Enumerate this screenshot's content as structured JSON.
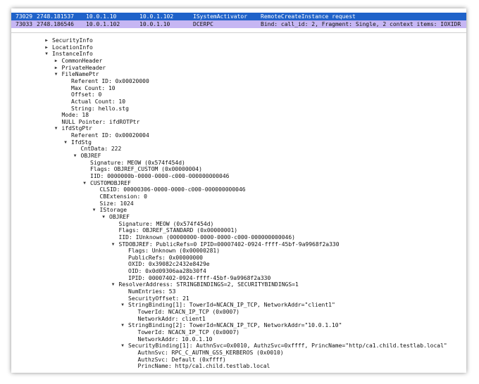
{
  "packet_list": [
    {
      "no": "73029",
      "time": "2748.181537",
      "src": "10.0.1.10",
      "dst": "10.0.1.102",
      "proto": "ISystemActivator",
      "info": "RemoteCreateInstance request",
      "selected": true
    },
    {
      "no": "73033",
      "time": "2748.186546",
      "src": "10.0.1.102",
      "dst": "10.0.1.10",
      "proto": "DCERPC",
      "info": "Bind: call_id: 2, Fragment: Single, 2 context items: IOXIDR",
      "selected": false
    }
  ],
  "detail_tree": [
    {
      "text": "SecurityInfo",
      "depth": 0,
      "toggle": "collapsed"
    },
    {
      "text": "LocationInfo",
      "depth": 0,
      "toggle": "collapsed"
    },
    {
      "text": "InstanceInfo",
      "depth": 0,
      "toggle": "expanded"
    },
    {
      "text": "CommonHeader",
      "depth": 1,
      "toggle": "collapsed"
    },
    {
      "text": "PrivateHeader",
      "depth": 1,
      "toggle": "collapsed"
    },
    {
      "text": "FileNamePtr",
      "depth": 1,
      "toggle": "expanded"
    },
    {
      "text": "Referent ID: 0x00020000",
      "depth": 2,
      "toggle": "none"
    },
    {
      "text": "Max Count: 10",
      "depth": 2,
      "toggle": "none"
    },
    {
      "text": "Offset: 0",
      "depth": 2,
      "toggle": "none"
    },
    {
      "text": "Actual Count: 10",
      "depth": 2,
      "toggle": "none"
    },
    {
      "text": "String: hello.stg",
      "depth": 2,
      "toggle": "none"
    },
    {
      "text": "Mode: 18",
      "depth": 1,
      "toggle": "none"
    },
    {
      "text": "NULL Pointer: ifdROTPtr",
      "depth": 1,
      "toggle": "none"
    },
    {
      "text": "ifdStgPtr",
      "depth": 1,
      "toggle": "expanded"
    },
    {
      "text": "Referent ID: 0x00020004",
      "depth": 2,
      "toggle": "none"
    },
    {
      "text": "IfdStg",
      "depth": 2,
      "toggle": "expanded"
    },
    {
      "text": "CntData: 222",
      "depth": 3,
      "toggle": "none"
    },
    {
      "text": "OBJREF",
      "depth": 3,
      "toggle": "expanded"
    },
    {
      "text": "Signature: MEOW (0x574f454d)",
      "depth": 4,
      "toggle": "none"
    },
    {
      "text": "Flags: OBJREF_CUSTOM (0x00000004)",
      "depth": 4,
      "toggle": "none"
    },
    {
      "text": "IID: 0000000b-0000-0000-c000-000000000046",
      "depth": 4,
      "toggle": "none"
    },
    {
      "text": "CUSTOMOBJREF",
      "depth": 4,
      "toggle": "expanded"
    },
    {
      "text": "CLSID: 00000306-0000-0000-c000-000000000046",
      "depth": 5,
      "toggle": "none"
    },
    {
      "text": "CBExtension: 0",
      "depth": 5,
      "toggle": "none"
    },
    {
      "text": "Size: 1024",
      "depth": 5,
      "toggle": "none"
    },
    {
      "text": "IStorage",
      "depth": 5,
      "toggle": "expanded"
    },
    {
      "text": "OBJREF",
      "depth": 6,
      "toggle": "expanded"
    },
    {
      "text": "Signature: MEOW (0x574f454d)",
      "depth": 7,
      "toggle": "none"
    },
    {
      "text": "Flags: OBJREF_STANDARD (0x00000001)",
      "depth": 7,
      "toggle": "none"
    },
    {
      "text": "IID: IUnknown (00000000-0000-0000-c000-000000000046)",
      "depth": 7,
      "toggle": "none"
    },
    {
      "text": "STDOBJREF: PublicRefs=0 IPID=00007402-0924-ffff-45bf-9a9968f2a330",
      "depth": 7,
      "toggle": "expanded"
    },
    {
      "text": "Flags: Unknown (0x00000281)",
      "depth": 8,
      "toggle": "none"
    },
    {
      "text": "PublicRefs: 0x00000000",
      "depth": 8,
      "toggle": "none"
    },
    {
      "text": "OXID: 0x39082c2432e8429e",
      "depth": 8,
      "toggle": "none"
    },
    {
      "text": "OID: 0x0d09306aa28b30f4",
      "depth": 8,
      "toggle": "none"
    },
    {
      "text": "IPID: 00007402-0924-ffff-45bf-9a9968f2a330",
      "depth": 8,
      "toggle": "none"
    },
    {
      "text": "ResolverAddress: STRINGBINDINGS=2, SECURITYBINDINGS=1",
      "depth": 7,
      "toggle": "expanded"
    },
    {
      "text": "NumEntries: 53",
      "depth": 8,
      "toggle": "none"
    },
    {
      "text": "SecurityOffset: 21",
      "depth": 8,
      "toggle": "none"
    },
    {
      "text": "StringBinding[1]: TowerId=NCACN_IP_TCP, NetworkAddr=\"client1\"",
      "depth": 8,
      "toggle": "expanded"
    },
    {
      "text": "TowerId: NCACN_IP_TCP (0x0007)",
      "depth": 9,
      "toggle": "none"
    },
    {
      "text": "NetworkAddr: client1",
      "depth": 9,
      "toggle": "none"
    },
    {
      "text": "StringBinding[2]: TowerId=NCACN_IP_TCP, NetworkAddr=\"10.0.1.10\"",
      "depth": 8,
      "toggle": "expanded"
    },
    {
      "text": "TowerId: NCACN_IP_TCP (0x0007)",
      "depth": 9,
      "toggle": "none"
    },
    {
      "text": "NetworkAddr: 10.0.1.10",
      "depth": 9,
      "toggle": "none"
    },
    {
      "text": "SecurityBinding[1]: AuthnSvc=0x0010, AuthzSvc=0xffff, PrincName=\"http/ca1.child.testlab.local\"",
      "depth": 8,
      "toggle": "expanded"
    },
    {
      "text": "AuthnSvc: RPC_C_AUTHN_GSS_KERBEROS (0x0010)",
      "depth": 9,
      "toggle": "none"
    },
    {
      "text": "AuthzSvc: Default (0xffff)",
      "depth": 9,
      "toggle": "none"
    },
    {
      "text": "PrincName: http/ca1.child.testlab.local",
      "depth": 9,
      "toggle": "none"
    }
  ],
  "icons": {
    "expanded": "triangle-down-icon",
    "collapsed": "triangle-right-icon"
  },
  "colors": {
    "selected_row": "#1f62c9",
    "dcerpc_row": "#c6b6f3"
  }
}
